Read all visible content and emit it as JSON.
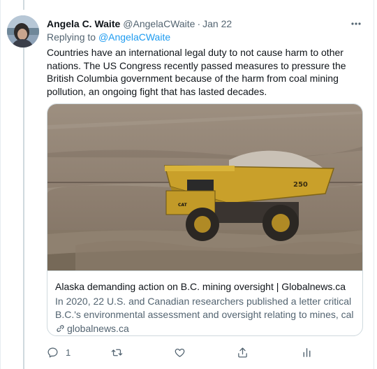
{
  "tweet": {
    "author_name": "Angela C. Waite",
    "author_handle": "@AngelaCWaite",
    "separator": "·",
    "time": "Jan 22",
    "replying_prefix": "Replying to",
    "replying_to": "@AngelaCWaite",
    "text": "Countries have an international legal duty to not cause harm to other nations. The US Congress recently passed measures to pressure the British Columbia government because of the harm from coal mining pollution, an ongoing fight that has lasted decades."
  },
  "card": {
    "title": "Alaska demanding action on B.C. mining oversight | Globalnews.ca",
    "description_line1": "In 2020, 22 U.S. and Canadian researchers published a letter critical of",
    "description_line2": "B.C.'s environmental assessment and oversight relating to mines, callin...",
    "domain": "globalnews.ca",
    "truck_number": "250",
    "truck_brand": "CAT"
  },
  "actions": {
    "reply_count": "1",
    "retweet_count": "",
    "like_count": ""
  },
  "icons": [
    "more-icon",
    "reply-icon",
    "retweet-icon",
    "like-icon",
    "share-icon",
    "analytics-icon",
    "link-icon"
  ],
  "colors": {
    "link": "#1d9bf0",
    "secondary_text": "#536471",
    "border": "#cfd9de"
  }
}
